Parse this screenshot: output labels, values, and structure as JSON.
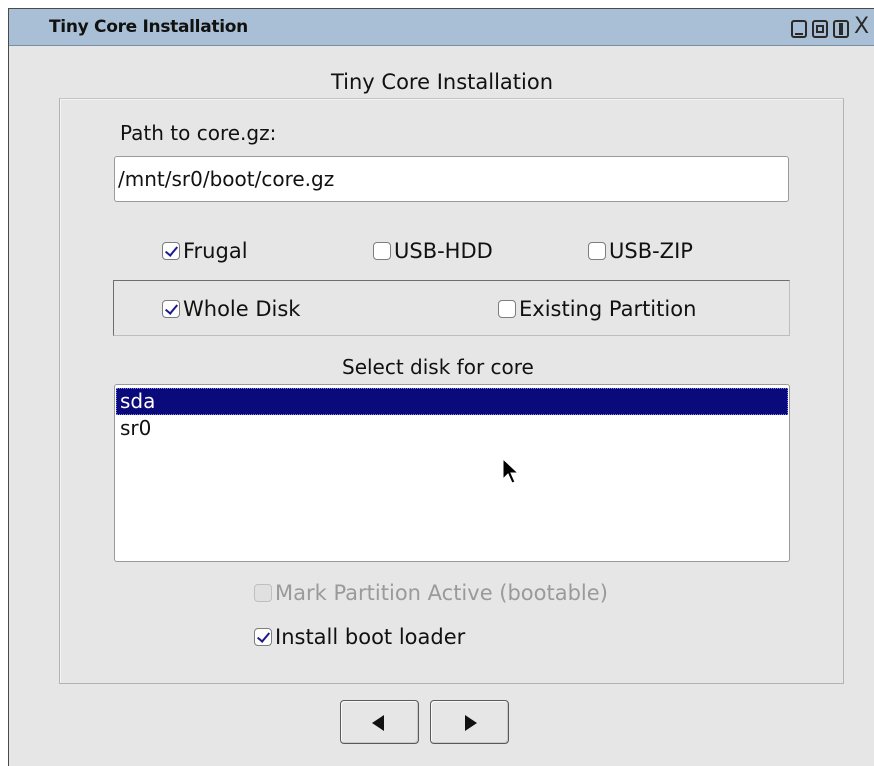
{
  "window": {
    "title": "Tiny Core Installation",
    "controls": [
      "minimize-icon",
      "restore-icon",
      "maximize-icon",
      "close-icon"
    ],
    "close_glyph": "X"
  },
  "dialog": {
    "heading": "Tiny Core Installation",
    "path_label": "Path to core.gz:",
    "path_value": "/mnt/sr0/boot/core.gz",
    "install_types": [
      {
        "label": "Frugal",
        "checked": true
      },
      {
        "label": "USB-HDD",
        "checked": false
      },
      {
        "label": "USB-ZIP",
        "checked": false
      }
    ],
    "target_options": [
      {
        "label": "Whole Disk",
        "checked": true
      },
      {
        "label": "Existing Partition",
        "checked": false
      }
    ],
    "disk_select_label": "Select disk for core",
    "disks": [
      {
        "name": "sda",
        "selected": true
      },
      {
        "name": "sr0",
        "selected": false
      }
    ],
    "mark_active": {
      "label": "Mark Partition Active (bootable)",
      "checked": false,
      "enabled": false
    },
    "boot_loader": {
      "label": "Install boot loader",
      "checked": true
    }
  },
  "navigation": {
    "back_icon": "triangle-left-icon",
    "next_icon": "triangle-right-icon"
  },
  "colors": {
    "titlebar": "#a9bfd6",
    "selection": "#0b0a7a",
    "check": "#1a1a8c",
    "window_bg": "#e6e6e6"
  }
}
